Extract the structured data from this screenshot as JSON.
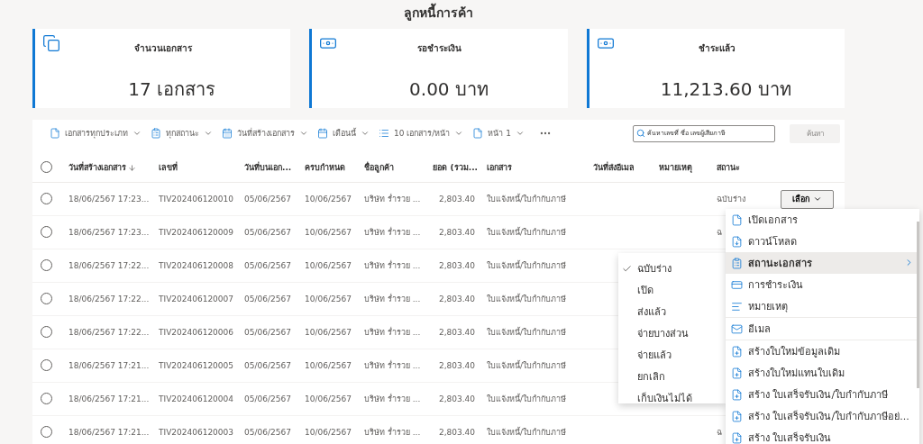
{
  "page_title": "ลูกหนี้การค้า",
  "cards": [
    {
      "kind": "documents",
      "title": "จำนวนเอกสาร",
      "value": "17 เอกสาร"
    },
    {
      "kind": "money",
      "title": "รอชำระเงิน",
      "value": "0.00 บาท"
    },
    {
      "kind": "money",
      "title": "ชำระแล้ว",
      "value": "11,213.60 บาท"
    }
  ],
  "toolbar": {
    "filters": [
      {
        "kind": "file",
        "label": "เอกสารทุกประเภท"
      },
      {
        "kind": "status",
        "label": "ทุกสถานะ"
      },
      {
        "kind": "calendar",
        "label": "วันที่สร้างเอกสาร"
      },
      {
        "kind": "month",
        "label": "เดือนนี้"
      },
      {
        "kind": "list",
        "label": "10 เอกสาร/หน้า"
      },
      {
        "kind": "file",
        "label": "หน้า 1"
      }
    ],
    "search": {
      "placeholder": "ค้นหาเลขที่ ชื่อ เลขผู้เสียภาษี"
    },
    "search_button": {
      "label": "ค้นหา",
      "disabled": true
    }
  },
  "table": {
    "select_all": {
      "checked": false
    },
    "columns": [
      {
        "label": "วันที่สร้างเอกสาร",
        "sorted": true
      },
      {
        "label": "เลขที่",
        "sorted": false
      },
      {
        "label": "วันที่บนเอก...",
        "sorted": false
      },
      {
        "label": "ครบกำหนด",
        "sorted": false
      },
      {
        "label": "ชื่อลูกค้า",
        "sorted": false
      },
      {
        "label": "ยอด (รวม...",
        "sorted": false
      },
      {
        "label": "เอกสาร",
        "sorted": false
      },
      {
        "label": "วันที่ส่งอีเมล",
        "sorted": false
      },
      {
        "label": "หมายเหตุ",
        "sorted": false
      },
      {
        "label": "สถานะ",
        "sorted": false
      }
    ],
    "rows": [
      {
        "created": "18/06/2567 17:23...",
        "selected": false,
        "number": "TIV202406120010",
        "doc_date": "05/06/2567",
        "due": "10/06/2567",
        "customer": "บริษัท ร่ำรวย ...",
        "amount": "2,803.40",
        "document": "ใบแจ้งหนี้/ใบกำกับภาษี",
        "status": "ฉบับร่าง",
        "action": "เลือก"
      },
      {
        "created": "18/06/2567 17:23...",
        "selected": false,
        "number": "TIV202406120009",
        "doc_date": "05/06/2567",
        "due": "10/06/2567",
        "customer": "บริษัท ร่ำรวย ...",
        "amount": "2,803.40",
        "document": "ใบแจ้งหนี้/ใบกำกับภาษี",
        "status": "ฉ"
      },
      {
        "created": "18/06/2567 17:22...",
        "selected": false,
        "number": "TIV202406120008",
        "doc_date": "05/06/2567",
        "due": "10/06/2567",
        "customer": "บริษัท ร่ำรวย ...",
        "amount": "2,803.40",
        "document": "ใบแจ้งหนี้/ใบกำกับภาษี"
      },
      {
        "created": "18/06/2567 17:22...",
        "selected": false,
        "number": "TIV202406120007",
        "doc_date": "05/06/2567",
        "due": "10/06/2567",
        "customer": "บริษัท ร่ำรวย ...",
        "amount": "2,803.40",
        "document": "ใบแจ้งหนี้/ใบกำกับภาษี"
      },
      {
        "created": "18/06/2567 17:22...",
        "selected": false,
        "number": "TIV202406120006",
        "doc_date": "05/06/2567",
        "due": "10/06/2567",
        "customer": "บริษัท ร่ำรวย ...",
        "amount": "2,803.40",
        "document": "ใบแจ้งหนี้/ใบกำกับภาษี"
      },
      {
        "created": "18/06/2567 17:21...",
        "selected": false,
        "number": "TIV202406120005",
        "doc_date": "05/06/2567",
        "due": "10/06/2567",
        "customer": "บริษัท ร่ำรวย ...",
        "amount": "2,803.40",
        "document": "ใบแจ้งหนี้/ใบกำกับภาษี"
      },
      {
        "created": "18/06/2567 17:21...",
        "selected": false,
        "number": "TIV202406120004",
        "doc_date": "05/06/2567",
        "due": "10/06/2567",
        "customer": "บริษัท ร่ำรวย ...",
        "amount": "2,803.40",
        "document": "ใบแจ้งหนี้/ใบกำกับภาษี"
      },
      {
        "created": "18/06/2567 17:21...",
        "selected": false,
        "number": "TIV202406120003",
        "doc_date": "05/06/2567",
        "due": "10/06/2567",
        "customer": "บริษัท ร่ำรวย ...",
        "amount": "2,803.40",
        "document": "ใบแจ้งหนี้/ใบกำกับภาษี",
        "status": "ฉ"
      }
    ]
  },
  "context_menu": {
    "items": [
      {
        "kind": "file",
        "label": "เปิดเอกสาร",
        "selected": false,
        "submenu": false,
        "divider_before": false
      },
      {
        "kind": "download",
        "label": "ดาวน์โหลด",
        "selected": false,
        "submenu": false,
        "divider_before": false
      },
      {
        "kind": "status",
        "label": "สถานะเอกสาร",
        "selected": true,
        "submenu": true,
        "divider_before": false
      },
      {
        "kind": "payment",
        "label": "การชำระเงิน",
        "selected": false,
        "submenu": false,
        "divider_before": false
      },
      {
        "kind": "note",
        "label": "หมายเหตุ",
        "selected": false,
        "submenu": false,
        "divider_before": false
      },
      {
        "kind": "mail",
        "label": "อีเมล",
        "selected": false,
        "submenu": false,
        "divider_before": true
      },
      {
        "kind": "create",
        "label": "สร้างใบใหม่ข้อมูลเดิม",
        "selected": false,
        "submenu": false,
        "divider_before": true
      },
      {
        "kind": "create",
        "label": "สร้างใบใหม่แทนใบเดิม",
        "selected": false,
        "submenu": false,
        "divider_before": false
      },
      {
        "kind": "create",
        "label": "สร้าง ใบเสร็จรับเงิน/ใบกำกับภาษี",
        "selected": false,
        "submenu": false,
        "divider_before": false
      },
      {
        "kind": "create",
        "label": "สร้าง ใบเสร็จรับเงิน/ใบกำกับภาษีอย่...",
        "selected": false,
        "submenu": false,
        "divider_before": false
      },
      {
        "kind": "create",
        "label": "สร้าง ใบเสร็จรับเงิน",
        "selected": false,
        "submenu": false,
        "divider_before": false
      }
    ]
  },
  "status_submenu": {
    "items": [
      {
        "label": "ฉบับร่าง",
        "checked": true
      },
      {
        "label": "เปิด",
        "checked": false
      },
      {
        "label": "ส่งแล้ว",
        "checked": false
      },
      {
        "label": "จ่ายบางส่วน",
        "checked": false
      },
      {
        "label": "จ่ายแล้ว",
        "checked": false
      },
      {
        "label": "ยกเลิก",
        "checked": false
      },
      {
        "label": "เก็บเงินไม่ได้",
        "checked": false
      }
    ]
  }
}
